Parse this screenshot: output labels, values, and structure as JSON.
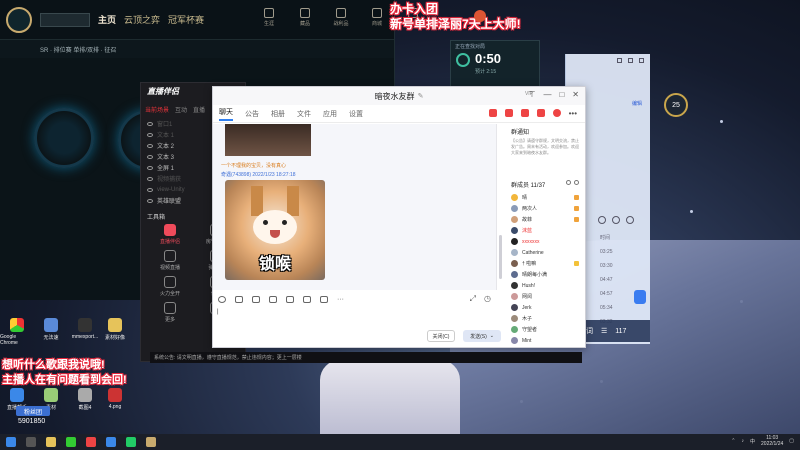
{
  "overlay": {
    "top_line1": "办卡入团",
    "top_line2": "新号单排泽丽7天上大师!",
    "bottom_line1": "想听什么歌跟我说哦!",
    "bottom_line2": "主播人在有问题看到会回!",
    "followers": "5901850",
    "fan_badge": "粉丝团"
  },
  "lol": {
    "nav": [
      "主页",
      "云顶之弈",
      "冠军杯赛"
    ],
    "icons": [
      "生涯",
      "藏品",
      "战利品",
      "商城",
      "帮助"
    ],
    "sub": "SR · 排位赛 单排/双排 · 征召"
  },
  "stream_app": {
    "title": "直播伴侣",
    "tabs": [
      "当前场景",
      "互动",
      "直播"
    ],
    "sources": [
      {
        "label": "窗口1",
        "dim": true
      },
      {
        "label": "文本 1",
        "dim": true
      },
      {
        "label": "文本 2",
        "dim": false
      },
      {
        "label": "文本 3",
        "dim": false
      },
      {
        "label": "全屏 1",
        "dim": false
      },
      {
        "label": "视频捕获",
        "dim": true
      },
      {
        "label": "view-Unity",
        "dim": true
      },
      {
        "label": "英雄联盟",
        "dim": false
      }
    ],
    "tools_heading": "工具箱",
    "tools": [
      "直播伴侣",
      "房管助手",
      "视频直播",
      "弹幕库",
      "火力全开",
      "伴侣",
      "更多",
      ""
    ]
  },
  "timer": {
    "label": "正在查找对局",
    "time": "0:50",
    "sub": "预计 2:15"
  },
  "level": "25",
  "right_panel": {
    "edit": "编辑",
    "times": [
      "时间",
      "03:25",
      "03:30",
      "04:47",
      "04:57",
      "05:34",
      "03:32"
    ],
    "bottom": [
      "词",
      "117"
    ]
  },
  "chat": {
    "title": "暗夜水友群",
    "tag": "VIP",
    "tabs": [
      "聊天",
      "公告",
      "相册",
      "文件",
      "应用",
      "设置"
    ],
    "note": "一个不理我的宝贝，没有真心",
    "sender": "奇遇(743898) 2022/1/23 18:27:18",
    "meme_text": "锁喉",
    "input_text": "|",
    "close_btn": "关闭(C)",
    "send_btn": "发送(S)",
    "notice_heading": "群通知",
    "notice_text": "【公告】请遵守群规，文明交流，禁止发广告。周末有活动，欢迎参加。欢迎大家来到暗夜水友群。",
    "members_heading": "群成员 11/37",
    "members": [
      {
        "name": "晴",
        "color": "#f2b63b",
        "badge": "#f0a33b",
        "red": false
      },
      {
        "name": "两次人",
        "color": "#8a9bb8",
        "badge": "#f0a33b",
        "red": false
      },
      {
        "name": "故菲",
        "color": "#d0a07a",
        "badge": "#f0a33b",
        "red": false
      },
      {
        "name": "沫蓝",
        "color": "#3a4b6a",
        "badge": "",
        "red": true
      },
      {
        "name": "xxxxxxx",
        "color": "#222",
        "badge": "",
        "red": true
      },
      {
        "name": "Catherine",
        "color": "#a6b5c8",
        "badge": "",
        "red": false
      },
      {
        "name": "† 啦嘛",
        "color": "#7a5f4f",
        "badge": "#f3c23a",
        "red": false
      },
      {
        "name": "晴朗每小满",
        "color": "#5d6c8f",
        "badge": "",
        "red": false
      },
      {
        "name": "Hush!",
        "color": "#333",
        "badge": "",
        "red": false
      },
      {
        "name": "网阅",
        "color": "#c99",
        "badge": "",
        "red": false
      },
      {
        "name": "Jerk",
        "color": "#445",
        "badge": "",
        "red": false
      },
      {
        "name": "木子",
        "color": "#9b8a7a",
        "badge": "",
        "red": false
      },
      {
        "name": "守望者",
        "color": "#6a7",
        "badge": "",
        "red": false
      },
      {
        "name": "Mint",
        "color": "#88a",
        "badge": "",
        "red": false
      }
    ]
  },
  "notice_bar": "系统公告: 请文明直播，遵守直播规范，禁止违规内容；更上一层楼",
  "desktop_icons": [
    "Google Chrome",
    "无法速",
    "mmexport...",
    "素材好像",
    "直播帮手",
    "素材",
    "5",
    "截图4",
    "4.png"
  ],
  "taskbar": {
    "time": "11:03",
    "date": "2022/1/24"
  },
  "colors": {
    "accent_blue": "#2f7ff0",
    "overlay_red": "#e8283c",
    "lol_gold": "#c8aa6e"
  }
}
